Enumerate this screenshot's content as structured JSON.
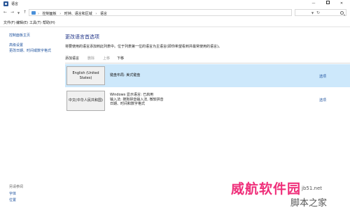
{
  "window": {
    "title": "语言",
    "minimize": "—",
    "close": "✕"
  },
  "address": {
    "breadcrumb": [
      "控制面板",
      "时钟、语言和区域",
      "语言"
    ],
    "sep": "›"
  },
  "menu": [
    "文件(F)",
    "编辑(E)",
    "工具(T)",
    "帮助(H)"
  ],
  "sidebar": {
    "home": "控制面板主页",
    "advanced": "高级设置",
    "datetime": "更改日期、时间或数字格式",
    "see_also": "另请参阅",
    "fonts": "字体",
    "location": "位置"
  },
  "main": {
    "title": "更改语言首选项",
    "description": "将要使用的语言添加到此列表中。位于列表第一位的语言为主语言(即你希望看到并最常使用的语言)。",
    "toolbar": {
      "add": "添加语言",
      "remove": "删除",
      "up": "上移",
      "down": "下移"
    },
    "languages": [
      {
        "name": "English (United States)",
        "info": [
          "键盘布局: 美式键盘"
        ],
        "options": "选项"
      },
      {
        "name": "中文(中华人民共和国)",
        "info": [
          "Windows 显示语言: 已启用",
          "输入法: 搜狗拼音输入法, 微软拼音",
          "日期、时间和数字格式"
        ],
        "options": "选项"
      }
    ]
  },
  "watermark": {
    "text": "威航软件园",
    "url": "jb51.net",
    "sub": "脚本之家"
  }
}
